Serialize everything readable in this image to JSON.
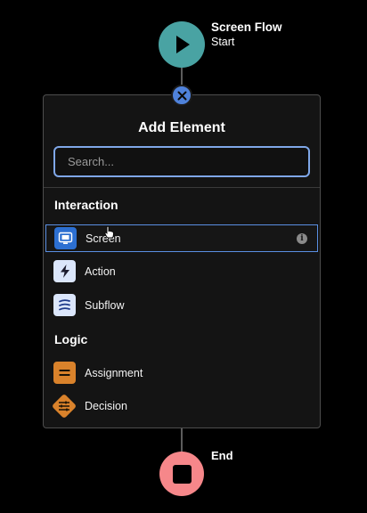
{
  "start_node": {
    "title": "Screen Flow",
    "subtitle": "Start",
    "icon": "play-icon",
    "color": "#49a3a3"
  },
  "panel": {
    "close_icon": "close-icon",
    "title": "Add Element",
    "search": {
      "placeholder": "Search...",
      "value": ""
    },
    "groups": [
      {
        "title": "Interaction",
        "items": [
          {
            "label": "Screen",
            "icon": "screen-icon",
            "color": "#2c6fd1",
            "selected": true,
            "info_icon": "info-icon"
          },
          {
            "label": "Action",
            "icon": "lightning-icon",
            "color": "#dbe6fb"
          },
          {
            "label": "Subflow",
            "icon": "subflow-icon",
            "color": "#dbe6fb"
          }
        ]
      },
      {
        "title": "Logic",
        "items": [
          {
            "label": "Assignment",
            "icon": "assignment-icon",
            "color": "#d9822b"
          },
          {
            "label": "Decision",
            "icon": "decision-icon",
            "color": "#d9822b"
          }
        ]
      }
    ]
  },
  "end_node": {
    "title": "End",
    "icon": "stop-icon",
    "color": "#f6878a"
  },
  "colors": {
    "background": "#000000",
    "accent": "#5a8fe2",
    "panel": "#141414"
  }
}
